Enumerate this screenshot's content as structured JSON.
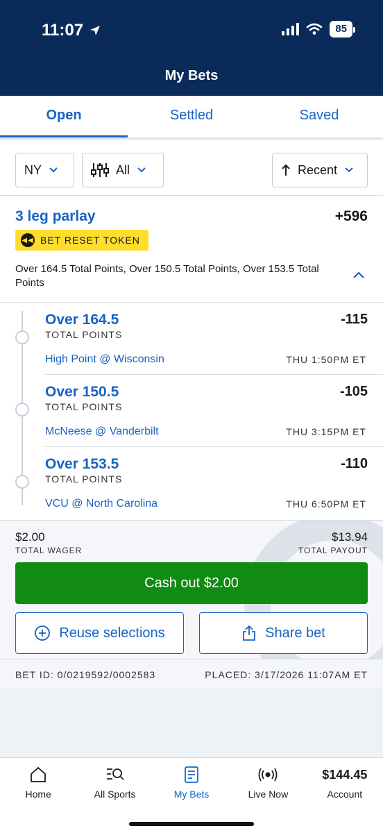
{
  "status_bar": {
    "time": "11:07",
    "battery": "85"
  },
  "header": {
    "title": "My Bets"
  },
  "tabs": [
    {
      "label": "Open",
      "active": true
    },
    {
      "label": "Settled",
      "active": false
    },
    {
      "label": "Saved",
      "active": false
    }
  ],
  "filters": {
    "state": "NY",
    "type": "All",
    "sort": "Recent"
  },
  "bet": {
    "title": "3 leg parlay",
    "odds": "+596",
    "token_label": "BET RESET TOKEN",
    "summary": "Over 164.5 Total Points, Over 150.5 Total Points, Over 153.5 Total Points",
    "legs": [
      {
        "selection": "Over 164.5",
        "market": "TOTAL POINTS",
        "odds": "-115",
        "game": "High Point @ Wisconsin",
        "time": "THU 1:50PM ET"
      },
      {
        "selection": "Over 150.5",
        "market": "TOTAL POINTS",
        "odds": "-105",
        "game": "McNeese @ Vanderbilt",
        "time": "THU 3:15PM ET"
      },
      {
        "selection": "Over 153.5",
        "market": "TOTAL POINTS",
        "odds": "-110",
        "game": "VCU @ North Carolina",
        "time": "THU 6:50PM ET"
      }
    ],
    "wager_amount": "$2.00",
    "wager_label": "TOTAL WAGER",
    "payout_amount": "$13.94",
    "payout_label": "TOTAL PAYOUT",
    "cashout_label": "Cash out $2.00",
    "reuse_label": "Reuse selections",
    "share_label": "Share bet",
    "bet_id": "BET ID: 0/0219592/0002583",
    "placed": "PLACED: 3/17/2026 11:07AM ET"
  },
  "bottom_nav": [
    {
      "label": "Home",
      "icon": "home-icon"
    },
    {
      "label": "All Sports",
      "icon": "search-list-icon"
    },
    {
      "label": "My Bets",
      "icon": "bet-slip-icon",
      "active": true
    },
    {
      "label": "Live Now",
      "icon": "live-broadcast-icon"
    },
    {
      "label": "Account",
      "balance": "$144.45"
    }
  ],
  "colors": {
    "brand_navy": "#0a2a5a",
    "accent_blue": "#1864c4",
    "cashout_green": "#128b12",
    "token_yellow": "#ffdd2e"
  }
}
